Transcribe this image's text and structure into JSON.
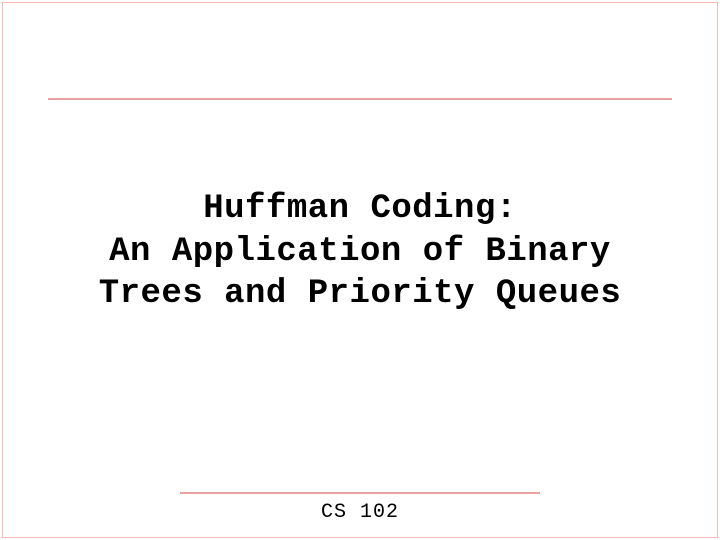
{
  "slide": {
    "title_line1": "Huffman Coding:",
    "title_line2": "An Application of Binary",
    "title_line3": "Trees and Priority Queues",
    "footer": "CS 102"
  },
  "colors": {
    "rule": "#e8a0a0",
    "border": "#f4b8b8",
    "text": "#000000",
    "background": "#ffffff"
  }
}
